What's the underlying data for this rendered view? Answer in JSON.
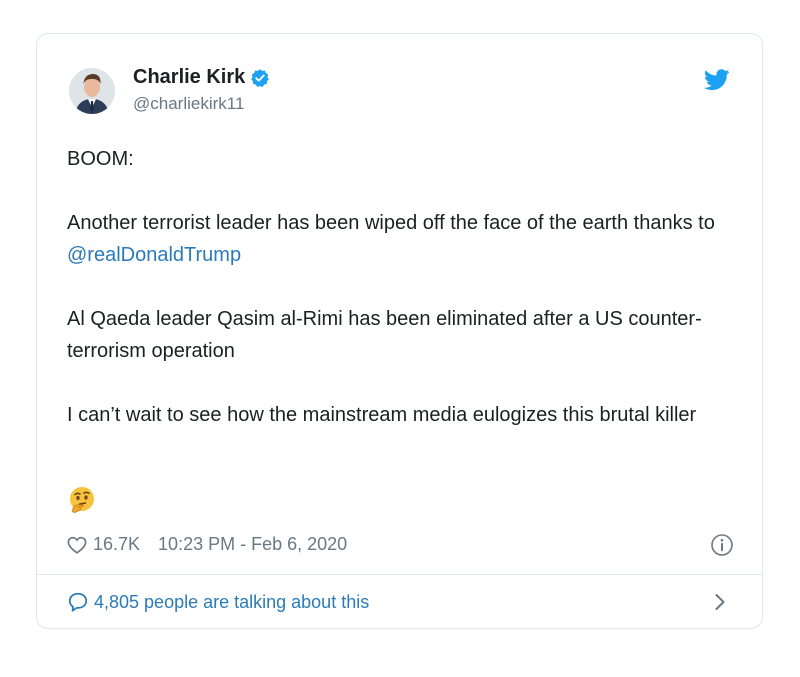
{
  "tweet": {
    "author": {
      "name": "Charlie Kirk",
      "handle": "@charliekirk11"
    },
    "text": {
      "p1": "BOOM:",
      "p2_before": "Another terrorist leader has been wiped off the face of the earth thanks to ",
      "p2_mention": "@realDonaldTrump",
      "p3": "Al Qaeda leader Qasim al-Rimi has been eliminated after a US counter-terrorism operation",
      "p4": "I can’t wait to see how the mainstream media eulogizes this brutal killer"
    },
    "emoji": "thinking-face",
    "likes": "16.7K",
    "timestamp": "10:23 PM - Feb 6, 2020",
    "talking": "4,805 people are talking about this"
  },
  "colors": {
    "link": "#2b7bb9",
    "verified": "#1da1f2",
    "muted": "#697882",
    "border": "#e1e8ed"
  },
  "icons": [
    "avatar",
    "verified-badge-icon",
    "twitter-bird-icon",
    "heart-icon",
    "info-icon",
    "speech-bubble-icon",
    "chevron-right-icon"
  ]
}
